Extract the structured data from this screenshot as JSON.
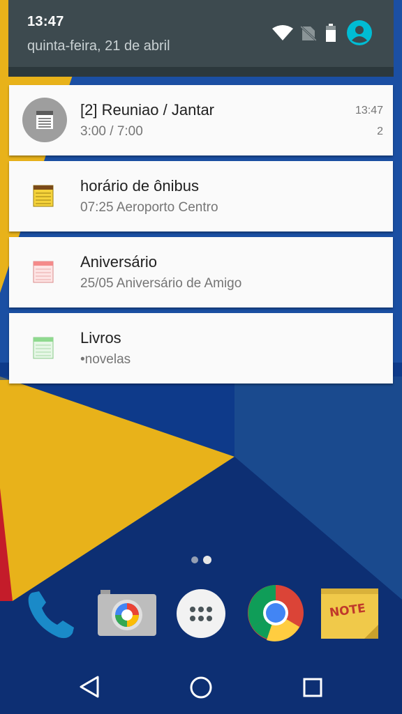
{
  "status": {
    "time": "13:47",
    "date": "quinta-feira, 21 de abril",
    "icons": [
      "wifi-icon",
      "no-sim-icon",
      "battery-icon",
      "account-icon"
    ]
  },
  "notifications": [
    {
      "title": "[2] Reuniao / Jantar",
      "subtitle": "3:00 / 7:00",
      "time": "13:47",
      "count": "2",
      "icon": "calendar-icon"
    },
    {
      "title": "horário de ônibus",
      "subtitle": "07:25 Aeroporto Centro",
      "icon": "notepad-yellow-icon",
      "color": "#f5d33b"
    },
    {
      "title": "Aniversário",
      "subtitle": "25/05 Aniversário de Amigo",
      "icon": "notepad-pink-icon",
      "color": "#f48a8a"
    },
    {
      "title": "Livros",
      "subtitle": "•novelas",
      "icon": "notepad-green-icon",
      "color": "#8fd98f"
    }
  ],
  "dock": {
    "apps": [
      "phone-icon",
      "camera-icon",
      "app-drawer-icon",
      "chrome-icon",
      "note-icon"
    ],
    "note_label": "NOTE"
  },
  "navigation": [
    "back-button",
    "home-button",
    "recents-button"
  ],
  "colors": {
    "accent": "#00bcd4",
    "wallpaper_blue": "#0d2f73",
    "wallpaper_yellow": "#e8b21a"
  }
}
